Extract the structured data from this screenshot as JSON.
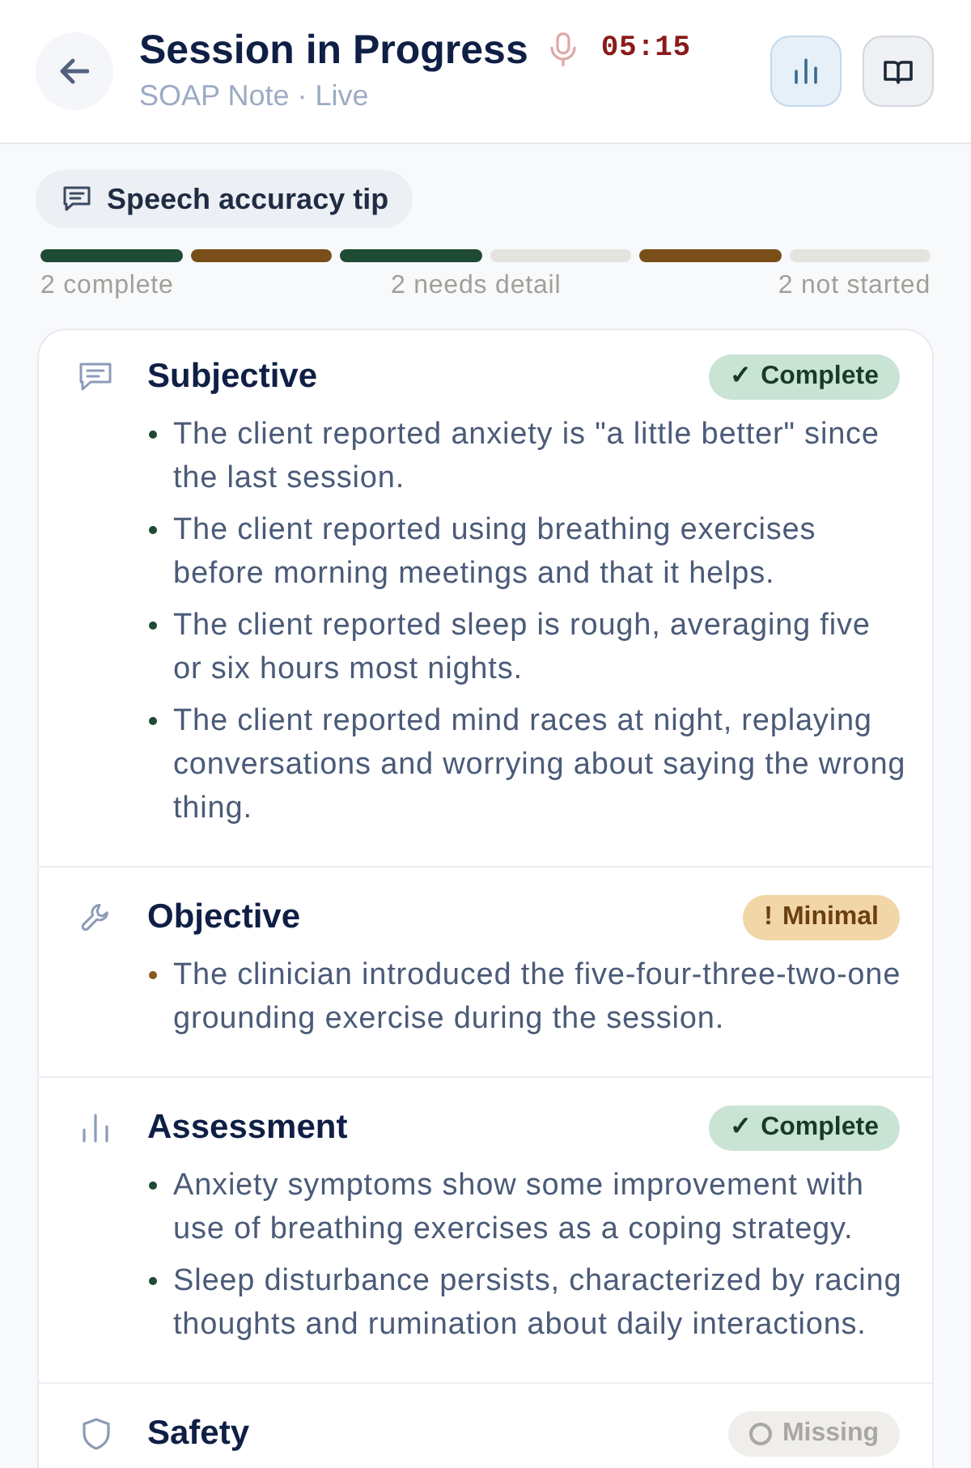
{
  "header": {
    "title": "Session in Progress",
    "timer": "05:15",
    "subtitle": "SOAP Note · Live",
    "buttons": [
      {
        "kind": "chart",
        "selected": true
      },
      {
        "kind": "book",
        "selected": false
      }
    ]
  },
  "tip": {
    "label": "Speech accuracy tip"
  },
  "progress": {
    "segments": [
      {
        "color": "#1f4a33"
      },
      {
        "color": "#7a4e18"
      },
      {
        "color": "#1f4a33"
      },
      {
        "color": "#e5e3dd"
      },
      {
        "color": "#7a4e18"
      },
      {
        "color": "#e5e3dd"
      }
    ],
    "labels": [
      "2 complete",
      "2 needs detail",
      "2 not started"
    ]
  },
  "sections": [
    {
      "title": "Subjective",
      "kind": "speech",
      "badge": {
        "kind": "complete",
        "symbol": "✓",
        "label": "Complete"
      },
      "bullets": [
        "The client reported anxiety is \"a little better\" since the last session.",
        "The client reported using breathing exercises before morning meetings and that it helps.",
        "The client reported sleep is rough, averaging five or six hours most nights.",
        "The client reported mind races at night, replaying conversations and worrying about saying the wrong thing."
      ]
    },
    {
      "title": "Objective",
      "kind": "tool",
      "badge": {
        "kind": "minimal",
        "symbol": "!",
        "label": "Minimal"
      },
      "bullets": [
        "The clinician introduced the five-four-three-two-one grounding exercise during the session."
      ]
    },
    {
      "title": "Assessment",
      "kind": "chart",
      "badge": {
        "kind": "complete",
        "symbol": "✓",
        "label": "Complete"
      },
      "bullets": [
        "Anxiety symptoms show some improvement with use of breathing exercises as a coping strategy.",
        "Sleep disturbance persists, characterized by racing thoughts and rumination about daily interactions."
      ]
    },
    {
      "title": "Safety",
      "kind": "shield",
      "badge": {
        "kind": "missing",
        "label": "Missing"
      }
    }
  ]
}
